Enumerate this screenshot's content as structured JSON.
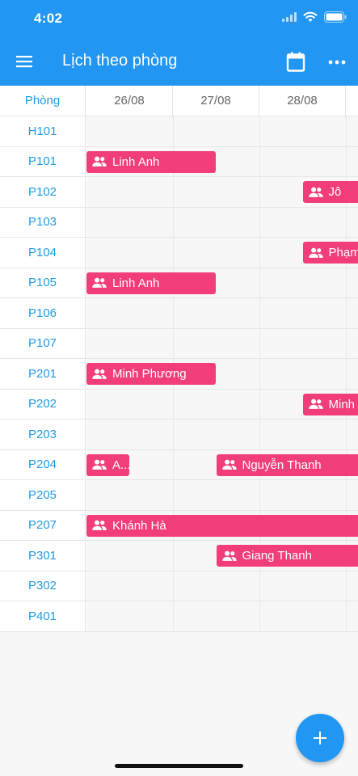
{
  "status": {
    "time": "4:02"
  },
  "appbar": {
    "title": "Lịch theo phòng"
  },
  "header": {
    "room_label": "Phòng",
    "dates": [
      "26/08",
      "27/08",
      "28/08"
    ]
  },
  "rooms": [
    "H101",
    "P101",
    "P102",
    "P103",
    "P104",
    "P105",
    "P106",
    "P107",
    "P201",
    "P202",
    "P203",
    "P204",
    "P205",
    "P207",
    "P301",
    "P302",
    "P401"
  ],
  "bookings": [
    {
      "room": "P101",
      "name": "Linh Anh",
      "start": 0,
      "span": 1.5
    },
    {
      "room": "P102",
      "name": "Jô",
      "start": 2.5,
      "span": 1
    },
    {
      "room": "P104",
      "name": "Phạm",
      "start": 2.5,
      "span": 1
    },
    {
      "room": "P105",
      "name": "Linh Anh",
      "start": 0,
      "span": 1.5
    },
    {
      "room": "P201",
      "name": "Minh Phương",
      "start": 0,
      "span": 1.5
    },
    {
      "room": "P202",
      "name": "Minh",
      "start": 2.5,
      "span": 1
    },
    {
      "room": "P204",
      "name": "A...",
      "start": 0,
      "span": 0.5
    },
    {
      "room": "P204",
      "name": "Nguyễn Thanh",
      "start": 1.5,
      "span": 2
    },
    {
      "room": "P207",
      "name": "Khánh Hà",
      "start": 0,
      "span": 3.5
    },
    {
      "room": "P301",
      "name": "Giang Thanh",
      "start": 1.5,
      "span": 2
    }
  ],
  "colors": {
    "primary": "#2196f3",
    "booking": "#f23d7b",
    "room_text": "#1e9be3"
  },
  "icons": {
    "menu": "menu-icon",
    "calendar": "calendar-icon",
    "more": "more-icon",
    "booking": "group-icon",
    "fab": "plus-icon"
  }
}
